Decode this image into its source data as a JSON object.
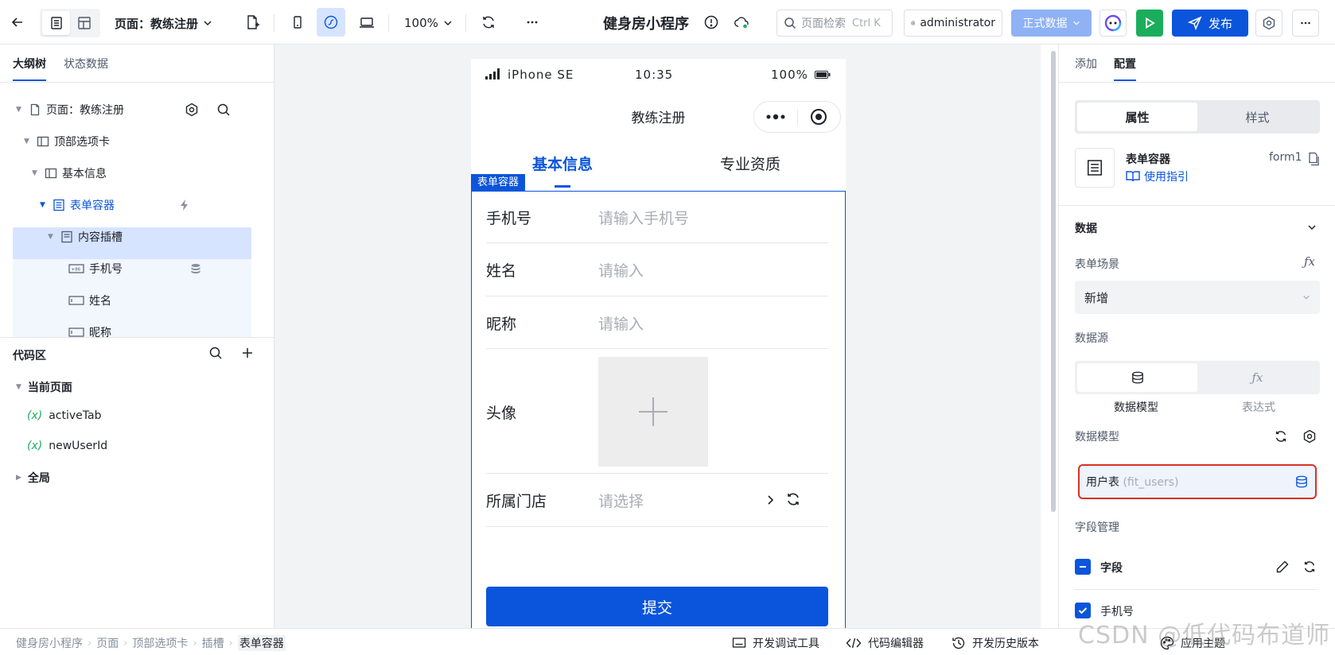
{
  "toolbar": {
    "page_select": "页面：教练注册",
    "zoom": "100%",
    "app_title": "健身房小程序",
    "search_placeholder": "页面检索",
    "search_shortcut": "Ctrl K",
    "user": "administrator",
    "data_env": "正式数据",
    "publish": "发布"
  },
  "left": {
    "tabs": [
      "大纲树",
      "状态数据"
    ],
    "tree": [
      {
        "label": "页面：教练注册"
      },
      {
        "label": "顶部选项卡"
      },
      {
        "label": "基本信息"
      },
      {
        "label": "表单容器"
      },
      {
        "label": "内容插槽"
      },
      {
        "label": "手机号"
      },
      {
        "label": "姓名"
      },
      {
        "label": "昵称"
      }
    ],
    "code": {
      "title": "代码区",
      "current_page": "当前页面",
      "vars": [
        "activeTab",
        "newUserId"
      ],
      "global": "全局"
    }
  },
  "phone": {
    "status": {
      "device": "iPhone SE",
      "time": "10:35",
      "battery": "100%"
    },
    "nav_title": "教练注册",
    "tabs": [
      "基本信息",
      "专业资质"
    ],
    "form_badge": "表单容器",
    "fields": [
      {
        "label": "手机号",
        "placeholder": "请输入手机号"
      },
      {
        "label": "姓名",
        "placeholder": "请输入"
      },
      {
        "label": "昵称",
        "placeholder": "请输入"
      },
      {
        "label": "头像",
        "placeholder": ""
      },
      {
        "label": "所属门店",
        "placeholder": "请选择"
      }
    ],
    "submit": "提交"
  },
  "right": {
    "tabs": [
      "添加",
      "配置"
    ],
    "seg": [
      "属性",
      "样式"
    ],
    "component": {
      "name": "表单容器",
      "id": "form1",
      "guide": "使用指引"
    },
    "data_section": "数据",
    "form_scene_label": "表单场景",
    "form_scene_value": "新增",
    "source_label": "数据源",
    "source_options": [
      "数据模型",
      "表达式"
    ],
    "model_label": "数据模型",
    "model_name": "用户表",
    "model_key": "(fit_users)",
    "fields_label": "字段管理",
    "fields_all": "字段",
    "field_1": "手机号"
  },
  "bottom": {
    "breadcrumb": [
      "健身房小程序",
      "页面",
      "顶部选项卡",
      "插槽",
      "表单容器"
    ],
    "tools": [
      "开发调试工具",
      "代码编辑器",
      "开发历史版本",
      "应用主题"
    ]
  },
  "watermark": "CSDN @低代码布道师"
}
